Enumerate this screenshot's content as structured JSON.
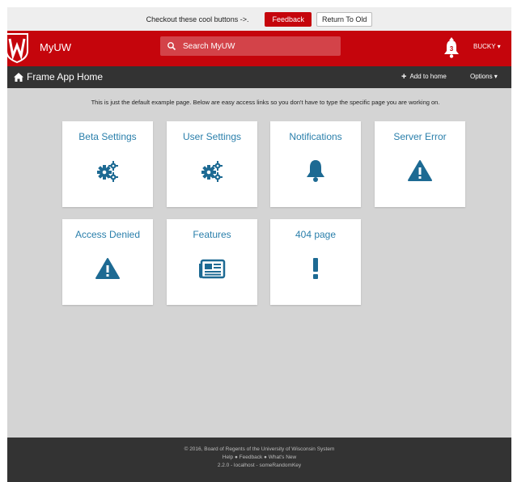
{
  "banner": {
    "text": "Checkout these cool buttons ->.",
    "feedback_label": "Feedback",
    "return_label": "Return To Old"
  },
  "header": {
    "brand": "MyUW",
    "search_placeholder": "Search MyUW",
    "notification_count": "3",
    "user": "BUCKY ▾"
  },
  "toolbar": {
    "title": "Frame App Home",
    "add_to_home": "Add to home",
    "options": "Options ▾"
  },
  "intro": "This is just the default example page. Below are easy access links so you don't have to type the specific page you are working on.",
  "tiles": [
    {
      "title": "Beta Settings",
      "icon": "cogs-icon"
    },
    {
      "title": "User Settings",
      "icon": "cogs-icon"
    },
    {
      "title": "Notifications",
      "icon": "bell-icon"
    },
    {
      "title": "Server Error",
      "icon": "warning-icon"
    },
    {
      "title": "Access Denied",
      "icon": "warning-icon"
    },
    {
      "title": "Features",
      "icon": "newspaper-icon"
    },
    {
      "title": "404 page",
      "icon": "exclamation-icon"
    }
  ],
  "footer": {
    "copyright": "© 2016, Board of Regents of the University of Wisconsin System",
    "links": "Help ● Feedback ● What's New",
    "version": "2.2.0 - localhost - someRandomKey"
  },
  "colors": {
    "brand_red": "#c5050c",
    "toolbar_dark": "#333333",
    "link_blue": "#2a7fab",
    "icon_blue": "#1d6a93",
    "background": "#d4d4d4"
  }
}
